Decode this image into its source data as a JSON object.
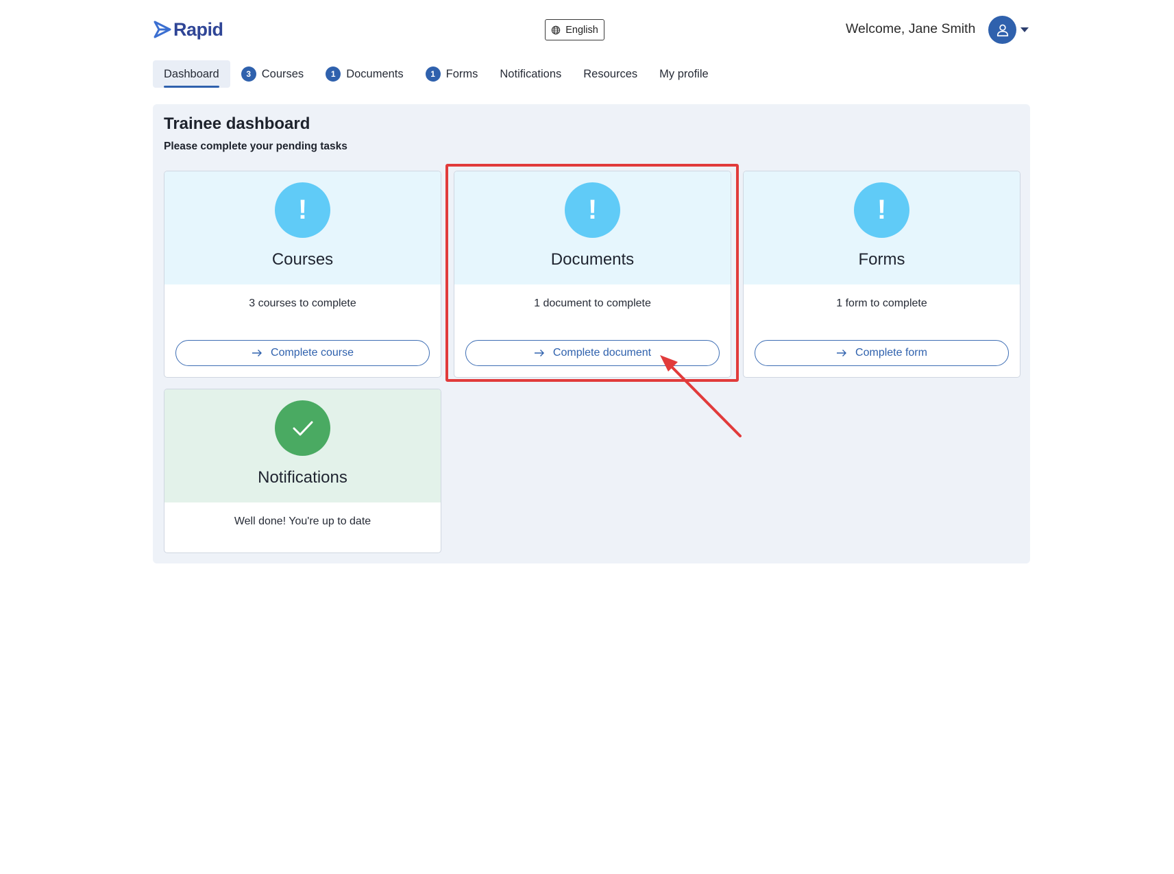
{
  "header": {
    "logo_text": "Rapid",
    "language_label": "English",
    "welcome_text": "Welcome, Jane Smith",
    "brand_color": "#2f61ad"
  },
  "nav": {
    "items": [
      {
        "label": "Dashboard",
        "badge": null,
        "active": true
      },
      {
        "label": "Courses",
        "badge": "3"
      },
      {
        "label": "Documents",
        "badge": "1"
      },
      {
        "label": "Forms",
        "badge": "1"
      },
      {
        "label": "Notifications",
        "badge": null
      },
      {
        "label": "Resources",
        "badge": null
      },
      {
        "label": "My profile",
        "badge": null
      }
    ]
  },
  "dashboard": {
    "title": "Trainee dashboard",
    "subtitle": "Please complete your pending tasks",
    "cards": [
      {
        "title": "Courses",
        "icon": "exclamation-icon",
        "text": "3 courses to complete",
        "button": "Complete course"
      },
      {
        "title": "Documents",
        "icon": "exclamation-icon",
        "text": "1 document to complete",
        "button": "Complete document"
      },
      {
        "title": "Forms",
        "icon": "exclamation-icon",
        "text": "1 form to complete",
        "button": "Complete form"
      },
      {
        "title": "Notifications",
        "icon": "checkmark-icon",
        "text": "Well done! You're up to date"
      }
    ]
  },
  "annotation": {
    "color": "#e13b3b"
  }
}
